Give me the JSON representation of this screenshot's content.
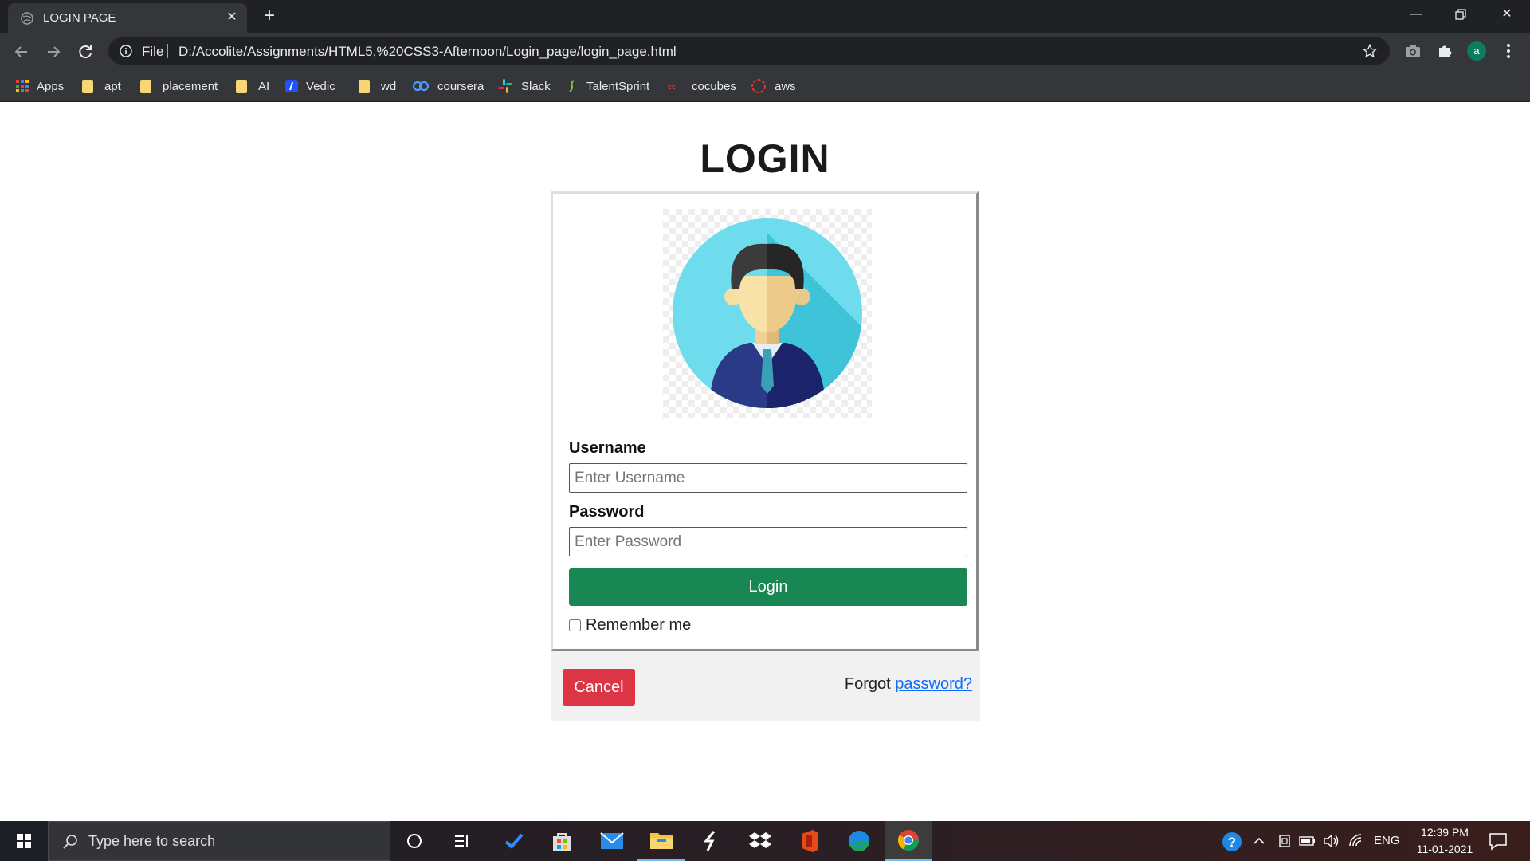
{
  "browser": {
    "tab_title": "LOGIN PAGE",
    "omnibox_scheme": "File",
    "url": "D:/Accolite/Assignments/HTML5,%20CSS3-Afternoon/Login_page/login_page.html",
    "profile_initial": "a",
    "bookmarks": [
      {
        "label": "Apps",
        "icon": "apps-grid-icon"
      },
      {
        "label": "apt",
        "icon": "folder-icon"
      },
      {
        "label": "placement",
        "icon": "folder-icon"
      },
      {
        "label": "AI",
        "icon": "folder-icon"
      },
      {
        "label": "Vedic",
        "icon": "vedic-icon"
      },
      {
        "label": "wd",
        "icon": "folder-icon"
      },
      {
        "label": "coursera",
        "icon": "coursera-icon"
      },
      {
        "label": "Slack",
        "icon": "slack-icon"
      },
      {
        "label": "TalentSprint",
        "icon": "talentsprint-icon"
      },
      {
        "label": "cocubes",
        "icon": "cocubes-icon"
      },
      {
        "label": "aws",
        "icon": "aws-icon"
      }
    ]
  },
  "page": {
    "heading": "LOGIN",
    "avatar_icon": "user-avatar-icon",
    "username_label": "Username",
    "username_placeholder": "Enter Username",
    "password_label": "Password",
    "password_placeholder": "Enter Password",
    "login_button": "Login",
    "remember_label": "Remember me",
    "remember_checked": false,
    "cancel_button": "Cancel",
    "forgot_text": "Forgot ",
    "forgot_link": "password?",
    "colors": {
      "login_button": "#198754",
      "cancel_button": "#dc3545",
      "link": "#0d6efd",
      "footer_bg": "#f1f1f1"
    }
  },
  "taskbar": {
    "search_placeholder": "Type here to search",
    "language": "ENG",
    "time": "12:39 PM",
    "date": "11-01-2021"
  }
}
